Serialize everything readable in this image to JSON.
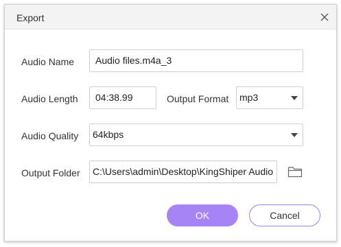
{
  "dialog": {
    "title": "Export",
    "close_icon": "close-icon"
  },
  "fields": {
    "audio_name": {
      "label": "Audio Name",
      "value": "Audio files.m4a_3"
    },
    "audio_length": {
      "label": "Audio Length",
      "value": "04:38.99"
    },
    "output_format": {
      "label": "Output Format",
      "value": "mp3"
    },
    "audio_quality": {
      "label": "Audio Quality",
      "value": "64kbps"
    },
    "output_folder": {
      "label": "Output Folder",
      "value": "C:\\Users\\admin\\Desktop\\KingShiper Audio",
      "icon": "folder-icon"
    }
  },
  "buttons": {
    "ok": "OK",
    "cancel": "Cancel"
  },
  "colors": {
    "accent": "#a784f6",
    "cancel_border": "#9f7ff0"
  }
}
